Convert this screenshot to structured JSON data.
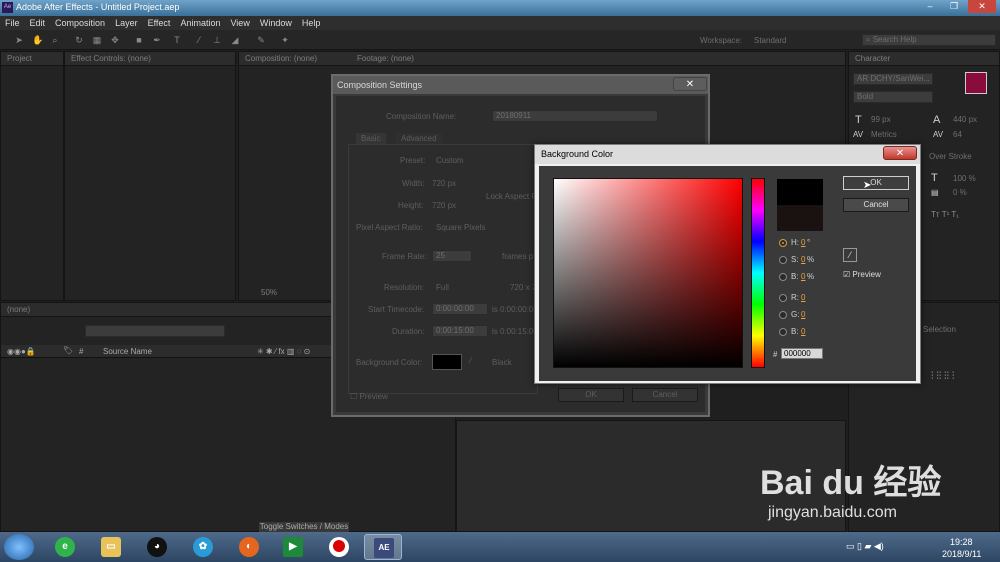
{
  "window": {
    "title": "Adobe After Effects - Untitled Project.aep",
    "app_icon": "Ae"
  },
  "menu": [
    "File",
    "Edit",
    "Composition",
    "Layer",
    "Effect",
    "Animation",
    "View",
    "Window",
    "Help"
  ],
  "toolbar": {
    "workspace_label": "Workspace:",
    "workspace_value": "Standard",
    "search_placeholder": "Search Help"
  },
  "panels": {
    "project_tab": "Project",
    "effect_controls_tab": "Effect Controls: (none)",
    "composition_tab": "Composition: (none)",
    "footage_tab": "Footage: (none)",
    "character_tab": "Character",
    "font_name": "AR DCHY/SanWei...",
    "font_style": "Bold",
    "font_size": "99 px",
    "leading": "440 px",
    "kerning": "Metrics",
    "tracking": "64",
    "stroke_mode": "Over Stroke",
    "vscale": "100 %",
    "baseline": "0 %",
    "zoom": "50%",
    "timeline_tab": "(none)",
    "source_name_col": "Source Name",
    "toggle_label": "Toggle Switches / Modes",
    "selection_label": "Selection"
  },
  "comp_dialog": {
    "title": "Composition Settings",
    "comp_name_label": "Composition Name:",
    "comp_name": "20180911",
    "tab_basic": "Basic",
    "tab_advanced": "Advanced",
    "preset_label": "Preset:",
    "preset": "Custom",
    "width_label": "Width:",
    "width": "720 px",
    "height_label": "Height:",
    "height": "720 px",
    "lock_label": "Lock Aspect R",
    "par_label": "Pixel Aspect Ratio:",
    "par": "Square Pixels",
    "fps_label": "Frame Rate:",
    "fps": "25",
    "fps_unit": "frames p",
    "res_label": "Resolution:",
    "res": "Full",
    "res_info": "720 x 7",
    "start_label": "Start Timecode:",
    "start": "0:00:00:00",
    "start_info": "is 0:00:00:00",
    "dur_label": "Duration:",
    "dur": "0:00:15:00",
    "dur_info": "is 0:00:15:00",
    "bg_label": "Background Color:",
    "bg_name": "Black",
    "preview_label": "Preview",
    "ok": "OK",
    "cancel": "Cancel"
  },
  "color_dialog": {
    "title": "Background Color",
    "close": "✕",
    "ok": "OK",
    "cancel": "Cancel",
    "preview_label": "Preview",
    "h_label": "H:",
    "h_val": "0",
    "h_unit": "°",
    "s_label": "S:",
    "s_val": "0",
    "s_unit": "%",
    "b_label": "B:",
    "b_val": "0",
    "b_unit": "%",
    "r_label": "R:",
    "r_val": "0",
    "g_label": "G:",
    "g_val": "0",
    "bl_label": "B:",
    "bl_val": "0",
    "hex_label": "#",
    "hex_val": "000000",
    "new_color": "#000000",
    "old_color": "#1a1111"
  },
  "taskbar": {
    "time": "19:28",
    "date": "2018/9/11"
  },
  "watermark": {
    "brand": "Bai du 经验",
    "url": "jingyan.baidu.com"
  }
}
